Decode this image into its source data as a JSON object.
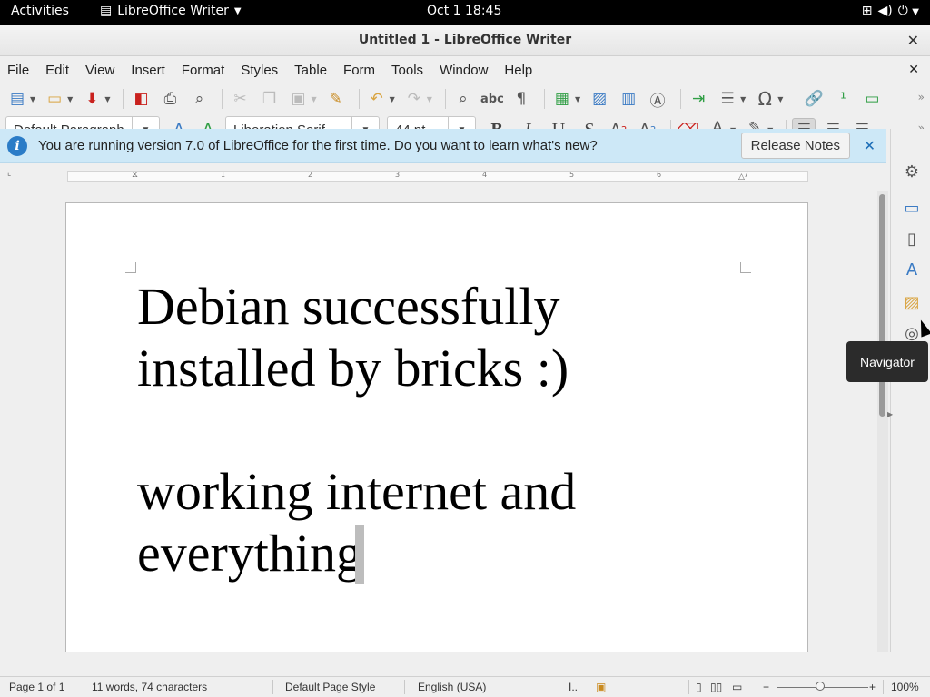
{
  "topbar": {
    "activities": "Activities",
    "app_name": "LibreOffice Writer",
    "clock": "Oct 1  18:45"
  },
  "window": {
    "title": "Untitled 1 - LibreOffice Writer"
  },
  "menubar": {
    "items": [
      "File",
      "Edit",
      "View",
      "Insert",
      "Format",
      "Styles",
      "Table",
      "Form",
      "Tools",
      "Window",
      "Help"
    ]
  },
  "formatting": {
    "paragraph_style": "Default Paragraph",
    "font_name": "Liberation Serif",
    "font_size": "44 pt",
    "bold": "B",
    "italic": "I",
    "underline": "U",
    "strike": "S"
  },
  "infobar": {
    "message": "You are running version 7.0 of LibreOffice for the first time. Do you want to learn what's new?",
    "release_notes_label": "Release Notes"
  },
  "document": {
    "paragraphs": [
      "Debian successfully installed by bricks :)",
      "",
      "working internet and everything"
    ]
  },
  "ruler": {
    "numbers": [
      "1",
      "2",
      "3",
      "4",
      "5",
      "6",
      "7"
    ]
  },
  "tooltip": {
    "text": "Navigator"
  },
  "statusbar": {
    "page": "Page 1 of 1",
    "word_count": "11 words, 74 characters",
    "page_style": "Default Page Style",
    "language": "English (USA)",
    "zoom": "100%",
    "zoom_minus": "−",
    "zoom_plus": "+"
  },
  "icons": {
    "close": "✕",
    "dropdown": "▾",
    "info": "i"
  },
  "colors": {
    "infobar_bg": "#cde8f7",
    "info_icon": "#2b7cc7",
    "font_color_accent": "#c9211e",
    "highlight_accent": "#ffff00"
  }
}
